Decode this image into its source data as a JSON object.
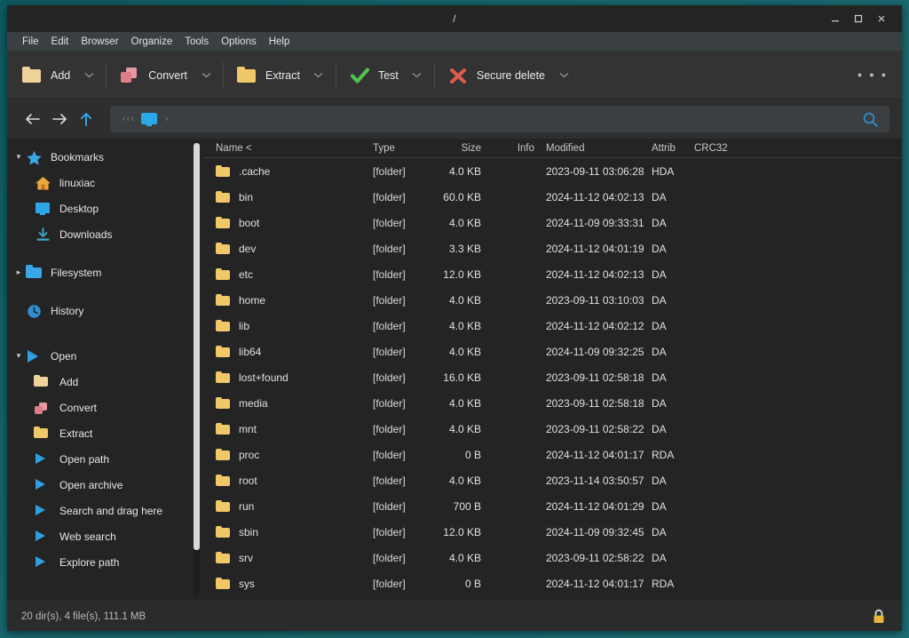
{
  "window": {
    "title": "/",
    "controls": {
      "minimize": "minimize-icon",
      "maximize": "maximize-icon",
      "close": "close-icon"
    }
  },
  "menubar": {
    "items": [
      "File",
      "Edit",
      "Browser",
      "Organize",
      "Tools",
      "Options",
      "Help"
    ]
  },
  "toolbar": {
    "buttons": [
      {
        "label": "Add",
        "icon": "folder-pale-icon",
        "has_arrow": true
      },
      {
        "label": "Convert",
        "icon": "convert-icon",
        "has_arrow": true
      },
      {
        "label": "Extract",
        "icon": "folder-yellow-icon",
        "has_arrow": true
      },
      {
        "label": "Test",
        "icon": "green-check-icon",
        "has_arrow": true
      },
      {
        "label": "Secure delete",
        "icon": "red-x-icon",
        "has_arrow": true
      }
    ],
    "overflow": "• • •"
  },
  "addressbar": {
    "back": "back-arrow-icon",
    "forward": "forward-arrow-icon",
    "up": "up-arrow-icon",
    "path_prefix": "‹‹‹",
    "crumb_icon": "computer-icon",
    "crumb_separator": "›",
    "search": "search-icon",
    "value": ""
  },
  "sidebar": {
    "groups": [
      {
        "label": "Bookmarks",
        "icon": "star-icon",
        "expanded": true,
        "twisty": "▾",
        "items": [
          {
            "label": "linuxiac",
            "icon": "home-icon"
          },
          {
            "label": "Desktop",
            "icon": "desktop-icon"
          },
          {
            "label": "Downloads",
            "icon": "download-icon"
          }
        ]
      },
      {
        "label": "Filesystem",
        "icon": "blue-folder-icon",
        "expanded": false,
        "twisty": "▸",
        "items": []
      },
      {
        "label": "History",
        "icon": "history-clock-icon",
        "expanded": null,
        "twisty": "",
        "items": []
      },
      {
        "label": "Open",
        "icon": "play-icon",
        "expanded": true,
        "twisty": "▾",
        "items": [
          {
            "label": "Add",
            "icon": "folder-pale-icon"
          },
          {
            "label": "Convert",
            "icon": "convert-icon"
          },
          {
            "label": "Extract",
            "icon": "folder-yellow-icon"
          },
          {
            "label": "Open path",
            "icon": "play-icon"
          },
          {
            "label": "Open archive",
            "icon": "play-icon"
          },
          {
            "label": "Search and drag here",
            "icon": "play-icon"
          },
          {
            "label": "Web search",
            "icon": "play-icon"
          },
          {
            "label": "Explore path",
            "icon": "play-icon"
          }
        ]
      }
    ]
  },
  "filelist": {
    "columns": [
      "Name <",
      "Type",
      "Size",
      "Info",
      "Modified",
      "Attrib",
      "CRC32"
    ],
    "sort_column": "Name",
    "sort_indicator": "<",
    "rows": [
      {
        "name": ".cache",
        "type": "[folder]",
        "size": "4.0 KB",
        "info": "",
        "modified": "2023-09-11 03:06:28",
        "attrib": "HDA",
        "crc32": ""
      },
      {
        "name": "bin",
        "type": "[folder]",
        "size": "60.0 KB",
        "info": "",
        "modified": "2024-11-12 04:02:13",
        "attrib": "DA",
        "crc32": ""
      },
      {
        "name": "boot",
        "type": "[folder]",
        "size": "4.0 KB",
        "info": "",
        "modified": "2024-11-09 09:33:31",
        "attrib": "DA",
        "crc32": ""
      },
      {
        "name": "dev",
        "type": "[folder]",
        "size": "3.3 KB",
        "info": "",
        "modified": "2024-11-12 04:01:19",
        "attrib": "DA",
        "crc32": ""
      },
      {
        "name": "etc",
        "type": "[folder]",
        "size": "12.0 KB",
        "info": "",
        "modified": "2024-11-12 04:02:13",
        "attrib": "DA",
        "crc32": ""
      },
      {
        "name": "home",
        "type": "[folder]",
        "size": "4.0 KB",
        "info": "",
        "modified": "2023-09-11 03:10:03",
        "attrib": "DA",
        "crc32": ""
      },
      {
        "name": "lib",
        "type": "[folder]",
        "size": "4.0 KB",
        "info": "",
        "modified": "2024-11-12 04:02:12",
        "attrib": "DA",
        "crc32": ""
      },
      {
        "name": "lib64",
        "type": "[folder]",
        "size": "4.0 KB",
        "info": "",
        "modified": "2024-11-09 09:32:25",
        "attrib": "DA",
        "crc32": ""
      },
      {
        "name": "lost+found",
        "type": "[folder]",
        "size": "16.0 KB",
        "info": "",
        "modified": "2023-09-11 02:58:18",
        "attrib": "DA",
        "crc32": ""
      },
      {
        "name": "media",
        "type": "[folder]",
        "size": "4.0 KB",
        "info": "",
        "modified": "2023-09-11 02:58:18",
        "attrib": "DA",
        "crc32": ""
      },
      {
        "name": "mnt",
        "type": "[folder]",
        "size": "4.0 KB",
        "info": "",
        "modified": "2023-09-11 02:58:22",
        "attrib": "DA",
        "crc32": ""
      },
      {
        "name": "proc",
        "type": "[folder]",
        "size": "0 B",
        "info": "",
        "modified": "2024-11-12 04:01:17",
        "attrib": "RDA",
        "crc32": ""
      },
      {
        "name": "root",
        "type": "[folder]",
        "size": "4.0 KB",
        "info": "",
        "modified": "2023-11-14 03:50:57",
        "attrib": "DA",
        "crc32": ""
      },
      {
        "name": "run",
        "type": "[folder]",
        "size": "700 B",
        "info": "",
        "modified": "2024-11-12 04:01:29",
        "attrib": "DA",
        "crc32": ""
      },
      {
        "name": "sbin",
        "type": "[folder]",
        "size": "12.0 KB",
        "info": "",
        "modified": "2024-11-09 09:32:45",
        "attrib": "DA",
        "crc32": ""
      },
      {
        "name": "srv",
        "type": "[folder]",
        "size": "4.0 KB",
        "info": "",
        "modified": "2023-09-11 02:58:22",
        "attrib": "DA",
        "crc32": ""
      },
      {
        "name": "sys",
        "type": "[folder]",
        "size": "0 B",
        "info": "",
        "modified": "2024-11-12 04:01:17",
        "attrib": "RDA",
        "crc32": ""
      }
    ]
  },
  "statusbar": {
    "summary": "20 dir(s), 4 file(s), 111.1 MB",
    "lock_icon": "padlock-icon"
  },
  "colors": {
    "desktop": "#17666c",
    "window_bg": "#2e2e2e",
    "titlebar": "#242424",
    "menubar": "#3a3f41",
    "toolbar": "#333333",
    "accent_blue": "#2f9fe0",
    "folder_yellow": "#f0c868",
    "convert_pink": "#e0818a",
    "check_green": "#4fc24f",
    "delete_red": "#e05a4f"
  }
}
